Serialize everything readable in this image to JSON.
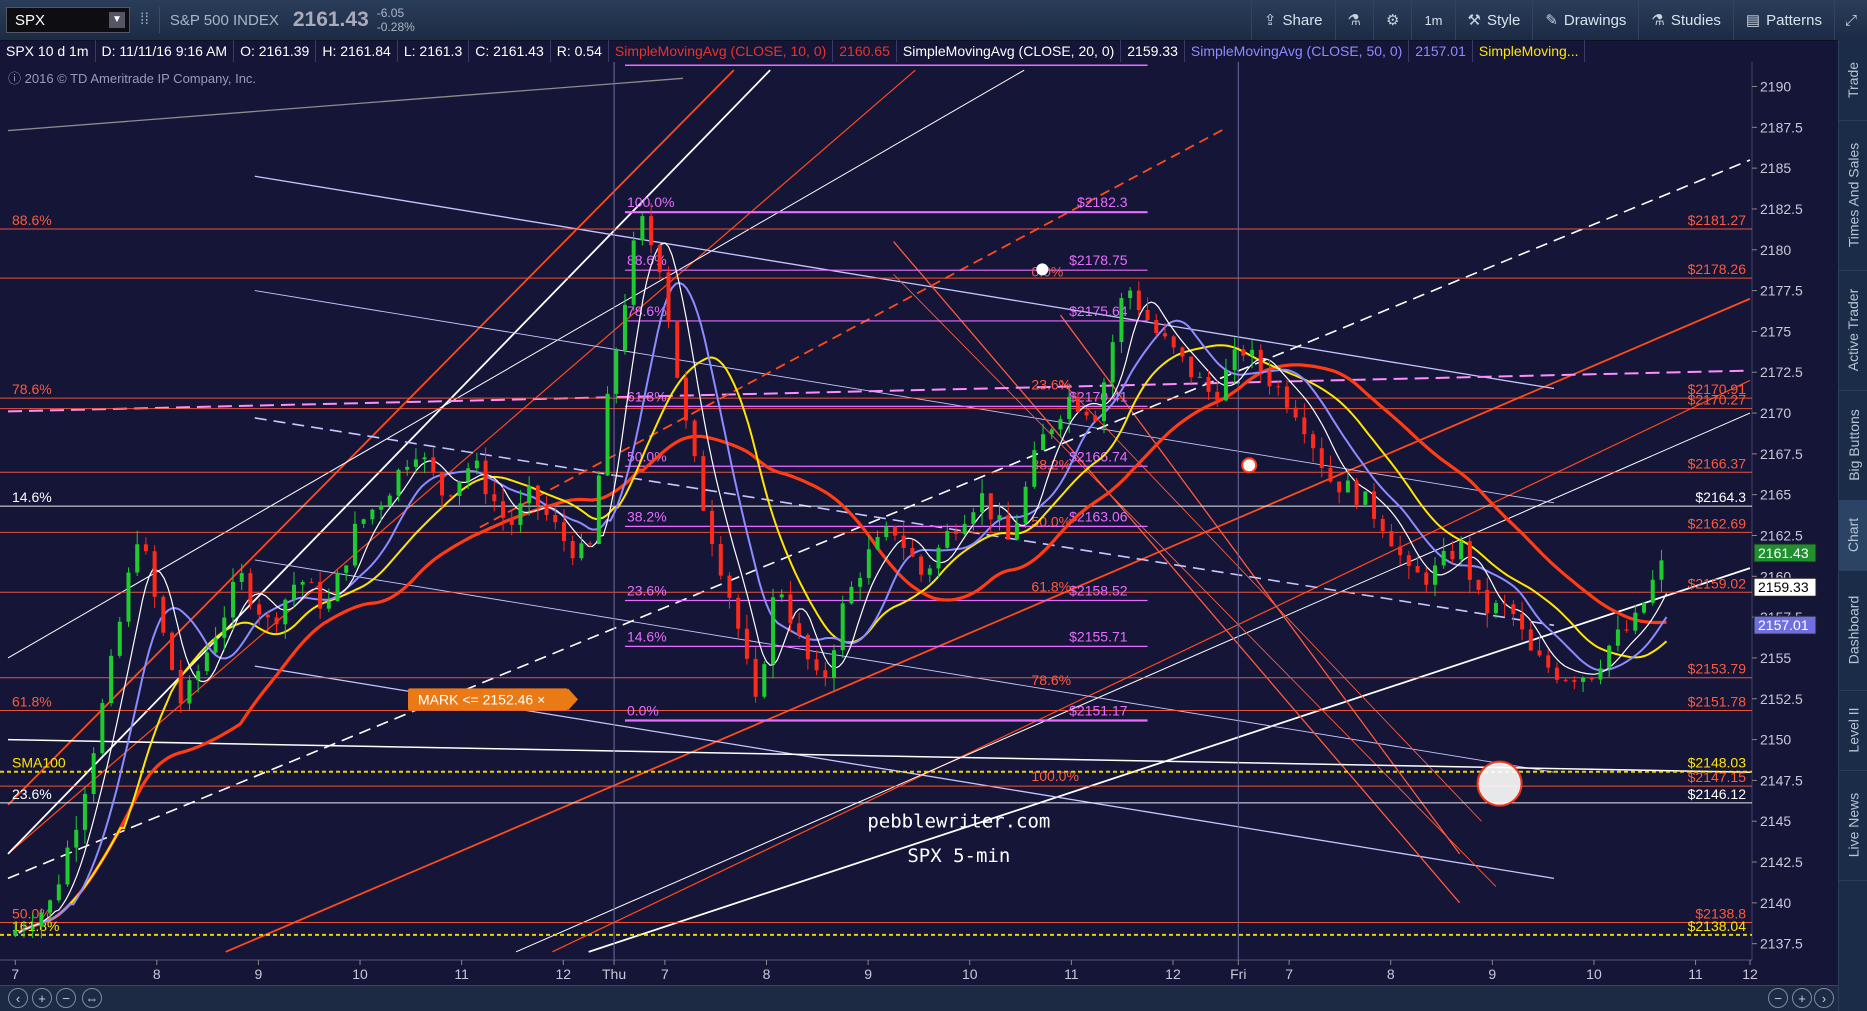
{
  "toolbar": {
    "symbol": "SPX",
    "index_name": "S&P 500 INDEX",
    "last_price": "2161.43",
    "change": "-6.05",
    "change_pct": "-0.28%",
    "interval": "1m",
    "buttons": [
      {
        "label": "Share",
        "icon": "share-icon"
      },
      {
        "label": "",
        "icon": "flask-icon"
      },
      {
        "label": "",
        "icon": "gear-icon"
      },
      {
        "label": "1m",
        "icon": ""
      },
      {
        "label": "Style",
        "icon": "style-icon"
      },
      {
        "label": "Drawings",
        "icon": "pencil-icon"
      },
      {
        "label": "Studies",
        "icon": "flask-icon"
      },
      {
        "label": "Patterns",
        "icon": "pattern-icon"
      }
    ]
  },
  "study_bar": [
    {
      "text": "SPX 10 d 1m",
      "color": "#ffffff"
    },
    {
      "text": "D: 11/11/16 9:16 AM",
      "color": "#ffffff"
    },
    {
      "text": "O: 2161.39",
      "color": "#ffffff"
    },
    {
      "text": "H: 2161.84",
      "color": "#ffffff"
    },
    {
      "text": "L: 2161.3",
      "color": "#ffffff"
    },
    {
      "text": "C: 2161.43",
      "color": "#ffffff"
    },
    {
      "text": "R: 0.54",
      "color": "#ffffff"
    },
    {
      "text": "SimpleMovingAvg (CLOSE, 10, 0)",
      "color": "#e8352a"
    },
    {
      "text": "2160.65",
      "color": "#e8352a"
    },
    {
      "text": "SimpleMovingAvg (CLOSE, 20, 0)",
      "color": "#ffffff"
    },
    {
      "text": "2159.33",
      "color": "#ffffff"
    },
    {
      "text": "SimpleMovingAvg (CLOSE, 50, 0)",
      "color": "#8c8cff"
    },
    {
      "text": "2157.01",
      "color": "#8c8cff"
    },
    {
      "text": "SimpleMoving...",
      "color": "#ffe600"
    }
  ],
  "copyright": "2016 © TD Ameritrade IP Company, Inc.",
  "right_tabs": [
    "Trade",
    "Times And Sales",
    "Active Trader",
    "Big Buttons",
    "Chart",
    "Dashboard",
    "Level II",
    "Live News"
  ],
  "watermark": {
    "line1": "pebblewriter.com",
    "line2": "SPX 5-min"
  },
  "mark_label": "MARK <= 2152.46 ×",
  "chart_data": {
    "type": "candlestick",
    "title": "SPX 10 d 1m",
    "ylim": [
      2136.5,
      2191.5
    ],
    "y_ticks": [
      2137.5,
      2140,
      2142.5,
      2145,
      2147.5,
      2150,
      2152.5,
      2155,
      2157.5,
      2160,
      2162.5,
      2165,
      2167.5,
      2170,
      2172.5,
      2175,
      2177.5,
      2180,
      2182.5,
      2185,
      2187.5,
      2190
    ],
    "x_ticks": [
      "7",
      "8",
      "9",
      "10",
      "11",
      "12",
      "Thu",
      "7",
      "8",
      "9",
      "10",
      "11",
      "12",
      "Fri",
      "7",
      "8",
      "9",
      "10",
      "11",
      "12"
    ],
    "price_path": [
      [
        0,
        2138
      ],
      [
        0.6,
        2140
      ],
      [
        1.0,
        2146
      ],
      [
        1.4,
        2154
      ],
      [
        1.8,
        2163
      ],
      [
        2.1,
        2157
      ],
      [
        2.4,
        2152
      ],
      [
        2.8,
        2156
      ],
      [
        3.2,
        2160
      ],
      [
        3.6,
        2157
      ],
      [
        4.0,
        2160
      ],
      [
        4.4,
        2158
      ],
      [
        4.8,
        2163
      ],
      [
        5.2,
        2165
      ],
      [
        5.6,
        2168
      ],
      [
        6.0,
        2165
      ],
      [
        6.4,
        2167
      ],
      [
        6.9,
        2163
      ],
      [
        7.2,
        2165
      ],
      [
        7.7,
        2162
      ],
      [
        8.0,
        2161
      ],
      [
        8.3,
        2172
      ],
      [
        8.7,
        2182
      ],
      [
        9.0,
        2179
      ],
      [
        9.3,
        2170
      ],
      [
        9.6,
        2164
      ],
      [
        10.0,
        2158
      ],
      [
        10.3,
        2152
      ],
      [
        10.6,
        2160
      ],
      [
        10.9,
        2156
      ],
      [
        11.2,
        2153
      ],
      [
        11.5,
        2158
      ],
      [
        11.8,
        2161
      ],
      [
        12.2,
        2163
      ],
      [
        12.6,
        2160
      ],
      [
        13.0,
        2163
      ],
      [
        13.4,
        2165
      ],
      [
        13.8,
        2162
      ],
      [
        14.2,
        2168
      ],
      [
        14.6,
        2171
      ],
      [
        15.0,
        2170
      ],
      [
        15.4,
        2178
      ],
      [
        15.8,
        2175
      ],
      [
        16.2,
        2173
      ],
      [
        16.6,
        2171
      ],
      [
        17.0,
        2174
      ],
      [
        17.4,
        2172
      ],
      [
        17.8,
        2170
      ],
      [
        18.2,
        2166
      ],
      [
        18.6,
        2165
      ],
      [
        19.0,
        2163
      ],
      [
        19.3,
        2160
      ],
      [
        19.6,
        2160
      ],
      [
        20.0,
        2162
      ],
      [
        20.3,
        2158
      ],
      [
        20.7,
        2158
      ],
      [
        21.0,
        2155
      ],
      [
        21.4,
        2154
      ],
      [
        21.8,
        2154
      ],
      [
        22.1,
        2156
      ],
      [
        22.4,
        2157
      ],
      [
        22.7,
        2160
      ],
      [
        22.9,
        2161.43
      ]
    ],
    "moving_averages": [
      {
        "name": "SimpleMovingAvg (CLOSE, 10, 0)",
        "value": 2160.65,
        "color": "#e8352a"
      },
      {
        "name": "SimpleMovingAvg (CLOSE, 20, 0)",
        "value": 2159.33,
        "color": "#ffffff"
      },
      {
        "name": "SimpleMovingAvg (CLOSE, 50, 0)",
        "value": 2157.01,
        "color": "#8c8cff"
      },
      {
        "name": "SimpleMoving...",
        "value": null,
        "color": "#ffe600"
      }
    ],
    "right_levels": [
      {
        "label": "$2181.27",
        "value": 2181.27,
        "color": "#ff5a3a",
        "box": false
      },
      {
        "label": "$2178.26",
        "value": 2178.26,
        "color": "#ff5a3a",
        "box": false
      },
      {
        "label": "$2170.91",
        "value": 2170.91,
        "color": "#ff5a3a",
        "box": false
      },
      {
        "label": "$2170.27",
        "value": 2170.27,
        "color": "#ff5a3a",
        "box": false
      },
      {
        "label": "$2166.37",
        "value": 2166.37,
        "color": "#ff5a3a",
        "box": false
      },
      {
        "label": "$2164.3",
        "value": 2164.3,
        "color": "#ffffff",
        "box": false
      },
      {
        "label": "$2162.69",
        "value": 2162.69,
        "color": "#ff5a3a",
        "box": false
      },
      {
        "label": "2161.43",
        "value": 2161.43,
        "color": "#1f8f2f",
        "box": true
      },
      {
        "label": "$2159.02",
        "value": 2159.02,
        "color": "#ff5a3a",
        "box": false
      },
      {
        "label": "2159.33",
        "value": 2159.33,
        "color": "#ffffff",
        "box": true
      },
      {
        "label": "2157.01",
        "value": 2157.01,
        "color": "#6f6fe0",
        "box": true
      },
      {
        "label": "$2153.79",
        "value": 2153.79,
        "color": "#ff5a3a",
        "box": false
      },
      {
        "label": "$2151.78",
        "value": 2151.78,
        "color": "#ff5a3a",
        "box": false
      },
      {
        "label": "$2148.03",
        "value": 2148.03,
        "color": "#ffe600",
        "box": false
      },
      {
        "label": "$2147.15",
        "value": 2147.15,
        "color": "#ff5a3a",
        "box": false
      },
      {
        "label": "$2146.12",
        "value": 2146.12,
        "color": "#ffffff",
        "box": false
      },
      {
        "label": "$2138.8",
        "value": 2138.8,
        "color": "#ff5a3a",
        "box": false
      },
      {
        "label": "$2138.04",
        "value": 2138.04,
        "color": "#ffe600",
        "box": false
      }
    ],
    "left_levels": [
      {
        "label": "88.6%",
        "value": 2181.27,
        "color": "#ff5a3a"
      },
      {
        "label": "78.6%",
        "value": 2170.91,
        "color": "#ff5a3a"
      },
      {
        "label": "14.6%",
        "value": 2164.3,
        "color": "#ffffff"
      },
      {
        "label": "61.8%",
        "value": 2151.78,
        "color": "#ff5a3a"
      },
      {
        "label": "SMA100",
        "value": 2148.03,
        "color": "#ffe600"
      },
      {
        "label": "23.6%",
        "value": 2146.12,
        "color": "#ffffff"
      },
      {
        "label": "50.0%",
        "value": 2138.8,
        "color": "#ff5a3a"
      },
      {
        "label": "161.8%",
        "value": 2138.04,
        "color": "#ffe600"
      }
    ],
    "fib_magenta": {
      "left_labels": [
        {
          "label": "100.0%",
          "value": 2182.3
        },
        {
          "label": "88.6%",
          "value": 2178.75
        },
        {
          "label": "78.6%",
          "value": 2175.64
        },
        {
          "label": "61.8%",
          "value": 2170.41
        },
        {
          "label": "50.0%",
          "value": 2166.74
        },
        {
          "label": "38.2%",
          "value": 2163.06
        },
        {
          "label": "23.6%",
          "value": 2158.52
        },
        {
          "label": "14.6%",
          "value": 2155.71
        },
        {
          "label": "0.0%",
          "value": 2151.17
        }
      ],
      "right_labels": [
        {
          "label": "$2182.3",
          "value": 2182.3
        },
        {
          "label": "$2178.75",
          "value": 2178.75
        },
        {
          "label": "$2175.64",
          "value": 2175.64
        },
        {
          "label": "$2170.41",
          "value": 2170.41
        },
        {
          "label": "$2166.74",
          "value": 2166.74
        },
        {
          "label": "$2163.06",
          "value": 2163.06
        },
        {
          "label": "$2158.52",
          "value": 2158.52
        },
        {
          "label": "$2155.71",
          "value": 2155.71
        },
        {
          "label": "$2151.17",
          "value": 2151.17
        }
      ]
    },
    "fib_red_labels": [
      {
        "label": "0.0%",
        "value": 2178.6
      },
      {
        "label": "23.6%",
        "value": 2171.7
      },
      {
        "label": "38.2%",
        "value": 2166.8
      },
      {
        "label": "50.0%",
        "value": 2163.3
      },
      {
        "label": "61.8%",
        "value": 2159.3
      },
      {
        "label": "78.6%",
        "value": 2153.6
      },
      {
        "label": "100.0%",
        "value": 2147.7
      }
    ],
    "mark_level": 2152.46
  }
}
